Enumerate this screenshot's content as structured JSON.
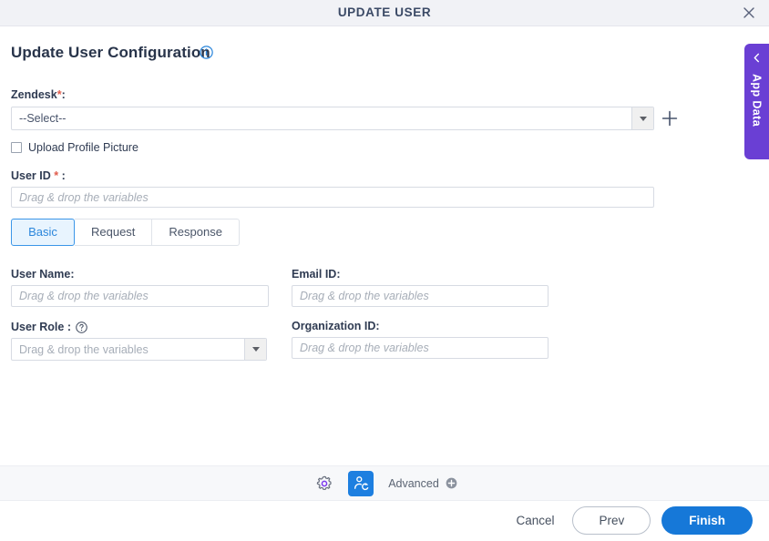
{
  "window": {
    "title": "UPDATE USER",
    "close_icon": "close-icon"
  },
  "header": {
    "page_title": "Update User Configuration",
    "info_icon": "info-icon"
  },
  "form": {
    "zendesk": {
      "label": "Zendesk",
      "required_mark": "*",
      "colon": ":",
      "value": "--Select--",
      "add_icon": "plus-icon"
    },
    "upload_profile_picture": {
      "label": "Upload Profile Picture",
      "checked": false
    },
    "user_id": {
      "label": "User ID",
      "required_mark": "*",
      "colon": ":",
      "placeholder": "Drag & drop the variables",
      "value": ""
    }
  },
  "tabs": [
    {
      "label": "Basic",
      "active": true
    },
    {
      "label": "Request",
      "active": false
    },
    {
      "label": "Response",
      "active": false
    }
  ],
  "basic_tab": {
    "user_name": {
      "label": "User Name:",
      "placeholder": "Drag & drop the variables",
      "value": ""
    },
    "email_id": {
      "label": "Email ID:",
      "placeholder": "Drag & drop the variables",
      "value": ""
    },
    "user_role": {
      "label": "User Role :",
      "help_icon": "question-mark-icon",
      "placeholder": "Drag & drop the variables",
      "value": ""
    },
    "organization_id": {
      "label": "Organization ID:",
      "placeholder": "Drag & drop the variables",
      "value": ""
    }
  },
  "toolbar": {
    "settings_icon": "gear-icon",
    "user_update_icon": "user-update-icon",
    "advanced_label": "Advanced",
    "advanced_add_icon": "plus-circle-icon"
  },
  "footer": {
    "cancel_label": "Cancel",
    "prev_label": "Prev",
    "finish_label": "Finish"
  },
  "side_panel": {
    "label": "App Data",
    "collapse_icon": "chevron-left-icon"
  },
  "colors": {
    "accent_blue": "#1678d8",
    "active_tab_blue": "#2b86db",
    "purple": "#6a3fd4",
    "required_red": "#e05b4b",
    "title_text": "#3b4a66"
  }
}
